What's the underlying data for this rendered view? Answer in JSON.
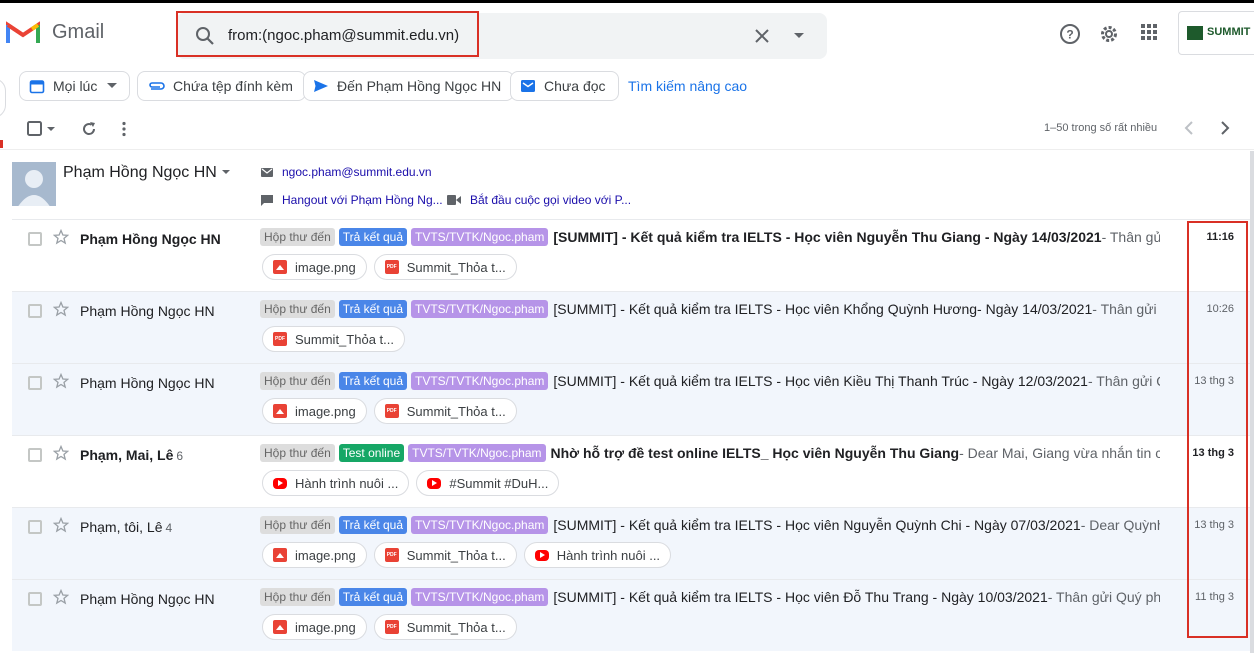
{
  "app": {
    "name": "Gmail"
  },
  "search": {
    "query": "from:(ngoc.pham@summit.edu.vn)"
  },
  "brand": {
    "text": "SUMMIT"
  },
  "chips": [
    {
      "label": "Mọi lúc"
    },
    {
      "label": "Chứa tệp đính kèm"
    },
    {
      "label": "Đến Phạm Hồng Ngọc HN"
    },
    {
      "label": "Chưa đọc"
    }
  ],
  "advanced_search": "Tìm kiếm nâng cao",
  "pager": "1–50 trong số rất nhiều",
  "contact": {
    "name": "Phạm Hồng Ngọc HN",
    "email": "ngoc.pham@summit.edu.vn",
    "hangout": "Hangout với Phạm Hồng Ng...",
    "video": "Bắt đầu cuộc gọi video với P..."
  },
  "colors": {
    "accent": "#1a73e8",
    "highlight": "#d93025",
    "label_blue": "#4a86e8",
    "label_purple": "#b694e8",
    "label_green": "#16a766"
  },
  "emails": [
    {
      "sender": "Phạm Hồng Ngọc HN",
      "count": "",
      "labels": [
        "Hộp thư đến",
        "Trả kết quả",
        "TVTS/TVTK/Ngoc.pham"
      ],
      "subject": "[SUMMIT] - Kết quả kiểm tra IELTS - Học viên Nguyễn Thu Giang - Ngày 14/03/2021",
      "snippet": " - Thân gửi Quý phụ...",
      "time": "11:16",
      "attachments": [
        {
          "type": "image",
          "name": "image.png"
        },
        {
          "type": "pdf",
          "name": "Summit_Thỏa t..."
        }
      ]
    },
    {
      "sender": "Phạm Hồng Ngọc HN",
      "count": "",
      "labels": [
        "Hộp thư đến",
        "Trả kết quả",
        "TVTS/TVTK/Ngoc.pham"
      ],
      "subject": "[SUMMIT] - Kết quả kiểm tra IELTS - Học viên Khổng Quỳnh Hương- Ngày 14/03/2021",
      "snippet": " - Thân gửi Quý phụ ...",
      "time": "10:26",
      "attachments": [
        {
          "type": "pdf",
          "name": "Summit_Thỏa t..."
        }
      ]
    },
    {
      "sender": "Phạm Hồng Ngọc HN",
      "count": "",
      "labels": [
        "Hộp thư đến",
        "Trả kết quả",
        "TVTS/TVTK/Ngoc.pham"
      ],
      "subject": "[SUMMIT] - Kết quả kiểm tra IELTS - Học viên Kiều Thị Thanh Trúc - Ngày 12/03/2021",
      "snippet": " - Thân gửi Quý phụ ...",
      "time": "13 thg 3",
      "attachments": [
        {
          "type": "image",
          "name": "image.png"
        },
        {
          "type": "pdf",
          "name": "Summit_Thỏa t..."
        }
      ]
    },
    {
      "sender": "Phạm, Mai, Lê",
      "count": "6",
      "labels": [
        "Hộp thư đến",
        "Test online",
        "TVTS/TVTK/Ngoc.pham"
      ],
      "subject": "Nhờ hỗ trợ đề test online IELTS_ Học viên Nguyễn Thu Giang",
      "snippet": " - Dear Mai, Giang vừa nhắn tin cho tớ muốn...",
      "time": "13 thg 3",
      "attachments": [
        {
          "type": "youtube",
          "name": "Hành trình nuôi ..."
        },
        {
          "type": "youtube",
          "name": "#Summit #DuH..."
        }
      ]
    },
    {
      "sender": "Phạm, tôi, Lê",
      "count": "4",
      "labels": [
        "Hộp thư đến",
        "Trả kết quả",
        "TVTS/TVTK/Ngoc.pham"
      ],
      "subject": "[SUMMIT] - Kết quả kiểm tra IELTS - Học viên Nguyễn Quỳnh Chi - Ngày 07/03/2021",
      "snippet": " - Dear Quỳnh Chi Nh...",
      "time": "13 thg 3",
      "attachments": [
        {
          "type": "image",
          "name": "image.png"
        },
        {
          "type": "pdf",
          "name": "Summit_Thỏa t..."
        },
        {
          "type": "youtube",
          "name": "Hành trình nuôi ..."
        }
      ]
    },
    {
      "sender": "Phạm Hồng Ngọc HN",
      "count": "",
      "labels": [
        "Hộp thư đến",
        "Trả kết quả",
        "TVTS/TVTK/Ngoc.pham"
      ],
      "subject": "[SUMMIT] - Kết quả kiểm tra IELTS - Học viên Đỗ Thu Trang - Ngày 10/03/2021",
      "snippet": " - Thân gửi Quý phụ huynh ...",
      "time": "11 thg 3",
      "attachments": [
        {
          "type": "image",
          "name": "image.png"
        },
        {
          "type": "pdf",
          "name": "Summit_Thỏa t..."
        }
      ]
    }
  ]
}
